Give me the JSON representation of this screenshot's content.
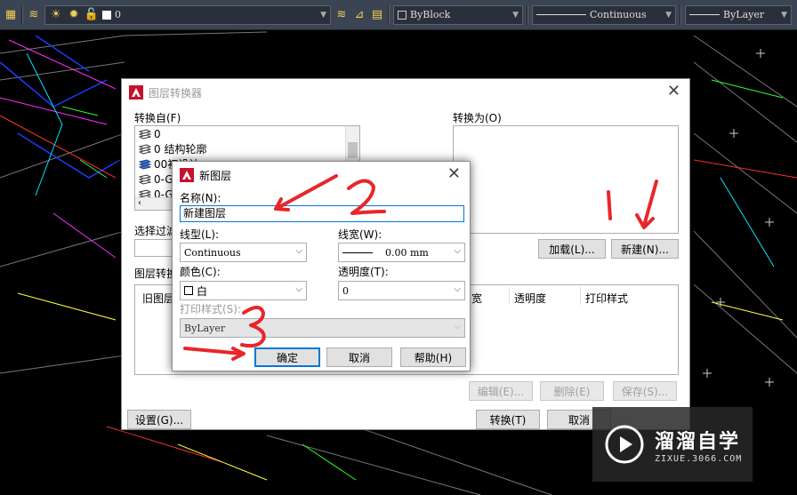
{
  "toolbar": {
    "layer_current": "0",
    "color_value": "ByBlock",
    "linetype_value": "Continuous",
    "lineweight_value": "ByLayer"
  },
  "converter": {
    "title": "图层转换器",
    "convert_from_label": "转换自(F)",
    "convert_to_label": "转换为(O)",
    "layers_from": [
      "0",
      "0 结构轮廓",
      "00初设计",
      "0-GZ",
      "0-GZ"
    ],
    "select_filter_label": "选择过滤",
    "layer_map_label": "图层转换",
    "old_layer_header": "旧图层",
    "col_lineweight": "宽",
    "col_transparency": "透明度",
    "col_plotstyle": "打印样式",
    "load_button": "加载(L)...",
    "new_button": "新建(N)...",
    "edit_button": "编辑(E)...",
    "delete_button": "删除(E)",
    "save_button": "保存(S)...",
    "settings_button": "设置(G)...",
    "translate_button": "转换(T)",
    "cancel_button": "取消"
  },
  "newlayer": {
    "title": "新图层",
    "name_label": "名称(N):",
    "name_value": "新建图层",
    "linetype_label": "线型(L):",
    "linetype_value": "Continuous",
    "lineweight_label": "线宽(W):",
    "lineweight_value": "0.00 mm",
    "color_label": "颜色(C):",
    "color_value": "白",
    "transparency_label": "透明度(T):",
    "transparency_value": "0",
    "plotstyle_label": "打印样式(S):",
    "plotstyle_value": "ByLayer",
    "ok_button": "确定",
    "cancel_button": "取消",
    "help_button": "帮助(H)"
  },
  "watermark": {
    "text": "溜溜自学",
    "sub": "ZIXUE.3066.COM"
  },
  "colors": {
    "annotation": "#e8262a",
    "accent": "#0078d7"
  }
}
